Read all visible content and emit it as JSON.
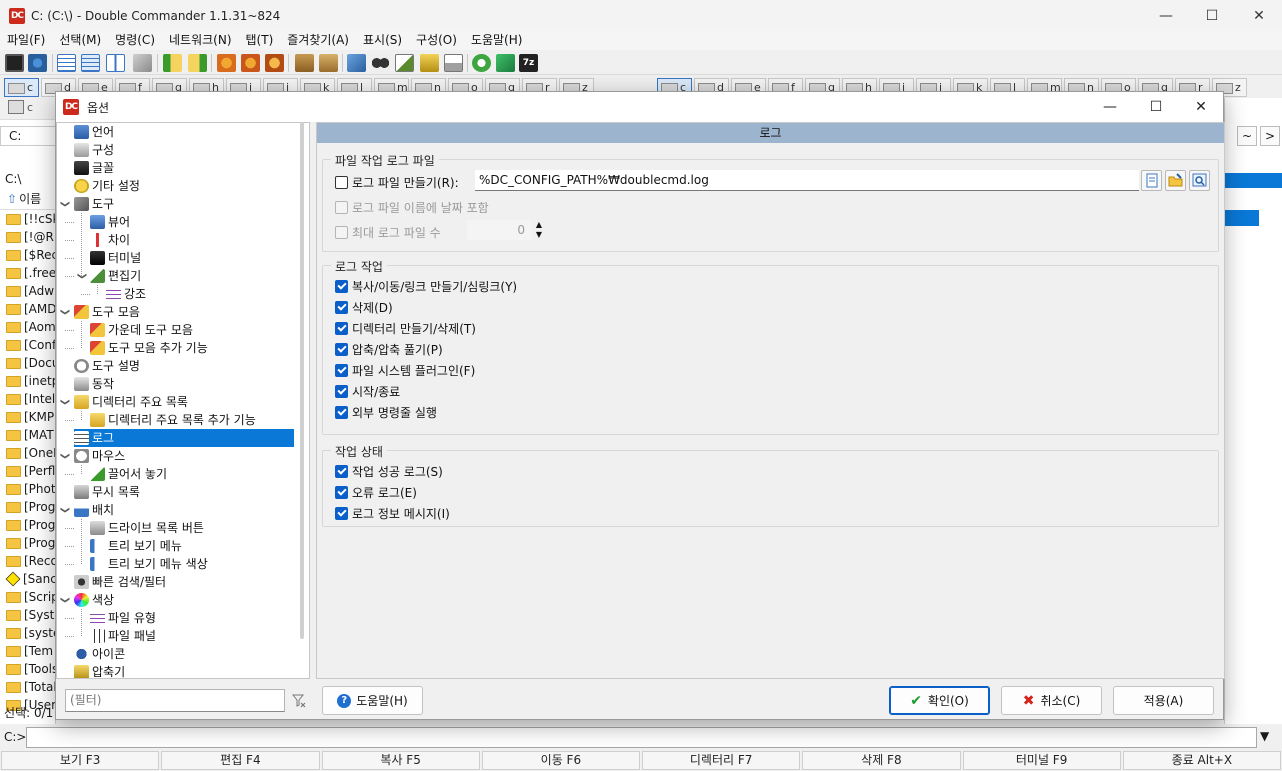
{
  "window": {
    "title": "C: (C:\\) - Double Commander 1.1.31~824",
    "logo": "DC",
    "minimize": "—",
    "maximize": "☐",
    "close": "✕"
  },
  "menu": [
    "파일(F)",
    "선택(M)",
    "명령(C)",
    "네트워크(N)",
    "탭(T)",
    "즐겨찾기(A)",
    "표시(S)",
    "구성(O)",
    "도움말(H)"
  ],
  "toolbar_label_7z": "7z",
  "left_drives": [
    "c",
    "d",
    "e",
    "f",
    "g",
    "h",
    "i",
    "j",
    "k",
    "l",
    "m",
    "n",
    "o",
    "q",
    "r",
    "z"
  ],
  "right_drives": [
    "c",
    "d",
    "e",
    "f",
    "g",
    "h",
    "i",
    "j",
    "k",
    "l",
    "m",
    "n",
    "o",
    "q",
    "r",
    "z"
  ],
  "left_panel": {
    "small_drive": "c",
    "path": "C:",
    "dir_label": "C:\\",
    "header": "이름",
    "up_arrow": "⇧",
    "rows": [
      "[!!cSk",
      "[!@RI",
      "[$Rec",
      "[.free",
      "[Adw",
      "[AMD",
      "[Aom",
      "[Conf",
      "[Docu",
      "[inetp",
      "[Intel",
      "[KMP",
      "[MAT",
      "[OneI",
      "[Perfl",
      "[Phot",
      "[Prog",
      "[Prog",
      "[Prog",
      "[Reco",
      "[Sanc",
      "[Scrip",
      "[Syste",
      "[syste",
      "[Tem",
      "[Tools",
      "[Total",
      "[User"
    ],
    "status": "선택: 0/1"
  },
  "right_top_controls": {
    "tilde": "~",
    "greater": ">",
    "path_arrow": "▼"
  },
  "command_line": {
    "prompt": "C:>",
    "dropdown": "▼"
  },
  "function_keys": [
    "보기 F3",
    "편집 F4",
    "복사 F5",
    "이동 F6",
    "디렉터리 F7",
    "삭제 F8",
    "터미널 F9",
    "종료 Alt+X"
  ],
  "dialog": {
    "title": "옵션",
    "tree": [
      {
        "label": "언어",
        "icon": "language-icon",
        "level": 0
      },
      {
        "label": "구성",
        "icon": "config-icon",
        "level": 0
      },
      {
        "label": "글꼴",
        "icon": "font-icon",
        "level": 0
      },
      {
        "label": "기타 설정",
        "icon": "misc-icon",
        "level": 0
      },
      {
        "label": "도구",
        "icon": "tools-icon",
        "level": 0,
        "expanded": true
      },
      {
        "label": "뷰어",
        "icon": "viewer-icon",
        "level": 1
      },
      {
        "label": "차이",
        "icon": "diff-icon",
        "level": 1
      },
      {
        "label": "터미널",
        "icon": "terminal-icon",
        "level": 1
      },
      {
        "label": "편집기",
        "icon": "editor-icon",
        "level": 1,
        "expanded": true
      },
      {
        "label": "강조",
        "icon": "highlight-icon",
        "level": 2
      },
      {
        "label": "도구 모음",
        "icon": "toolbar-icon",
        "level": 0,
        "expanded": true
      },
      {
        "label": "가운데 도구 모음",
        "icon": "middle-toolbar-icon",
        "level": 1
      },
      {
        "label": "도구 모음 추가 기능",
        "icon": "toolbar-extra-icon",
        "level": 1
      },
      {
        "label": "도구 설명",
        "icon": "tooltip-icon",
        "level": 0
      },
      {
        "label": "동작",
        "icon": "behavior-icon",
        "level": 0
      },
      {
        "label": "디렉터리 주요 목록",
        "icon": "hotlist-icon",
        "level": 0,
        "expanded": true
      },
      {
        "label": "디렉터리 주요 목록 추가 기능",
        "icon": "hotlist-extra-icon",
        "level": 1
      },
      {
        "label": "로그",
        "icon": "log-icon",
        "level": 0,
        "selected": true
      },
      {
        "label": "마우스",
        "icon": "mouse-icon",
        "level": 0,
        "expanded": true
      },
      {
        "label": "끌어서 놓기",
        "icon": "drag-drop-icon",
        "level": 1
      },
      {
        "label": "무시 목록",
        "icon": "ignore-list-icon",
        "level": 0
      },
      {
        "label": "배치",
        "icon": "layout-icon",
        "level": 0,
        "expanded": true
      },
      {
        "label": "드라이브 목록 버튼",
        "icon": "drive-list-icon",
        "level": 1
      },
      {
        "label": "트리 보기 메뉴",
        "icon": "tree-menu-icon",
        "level": 1
      },
      {
        "label": "트리 보기 메뉴 색상",
        "icon": "tree-menu-color-icon",
        "level": 1
      },
      {
        "label": "빠른 검색/필터",
        "icon": "quick-search-icon",
        "level": 0
      },
      {
        "label": "색상",
        "icon": "colors-icon",
        "level": 0,
        "expanded": true
      },
      {
        "label": "파일 유형",
        "icon": "file-types-icon",
        "level": 1
      },
      {
        "label": "파일 패널",
        "icon": "file-panel-icon",
        "level": 1
      },
      {
        "label": "아이콘",
        "icon": "icons-icon",
        "level": 0
      },
      {
        "label": "압축기",
        "icon": "archiver-icon",
        "level": 0
      }
    ],
    "filter_placeholder": "(필터)",
    "page_title": "로그",
    "file_log": {
      "title": "파일 작업 로그 파일",
      "create_log": {
        "label": "로그 파일 만들기(R):",
        "checked": false
      },
      "path": "%DC_CONFIG_PATH%₩doublecmd.log",
      "include_date": {
        "label": "로그 파일 이름에 날짜 포함",
        "checked": false
      },
      "max_files": {
        "label": "최대 로그 파일 수",
        "value": "0"
      }
    },
    "log_operations": {
      "title": "로그 작업",
      "items": [
        {
          "label": "복사/이동/링크 만들기/심링크(Y)",
          "checked": true
        },
        {
          "label": "삭제(D)",
          "checked": true
        },
        {
          "label": "디렉터리 만들기/삭제(T)",
          "checked": true
        },
        {
          "label": "압축/압축 풀기(P)",
          "checked": true
        },
        {
          "label": "파일 시스템 플러그인(F)",
          "checked": true
        },
        {
          "label": "시작/종료",
          "checked": true
        },
        {
          "label": "외부 명령줄 실행",
          "checked": true
        }
      ]
    },
    "op_status": {
      "title": "작업 상태",
      "items": [
        {
          "label": "작업 성공 로그(S)",
          "checked": true
        },
        {
          "label": "오류 로그(E)",
          "checked": true
        },
        {
          "label": "로그 정보 메시지(I)",
          "checked": true
        }
      ]
    },
    "buttons": {
      "help": "도움말(H)",
      "ok": "확인(O)",
      "cancel": "취소(C)",
      "apply": "적용(A)"
    },
    "help_glyph": "?",
    "ok_glyph": "✔",
    "cancel_glyph": "✖",
    "spin_up": "▲",
    "spin_down": "▼"
  }
}
